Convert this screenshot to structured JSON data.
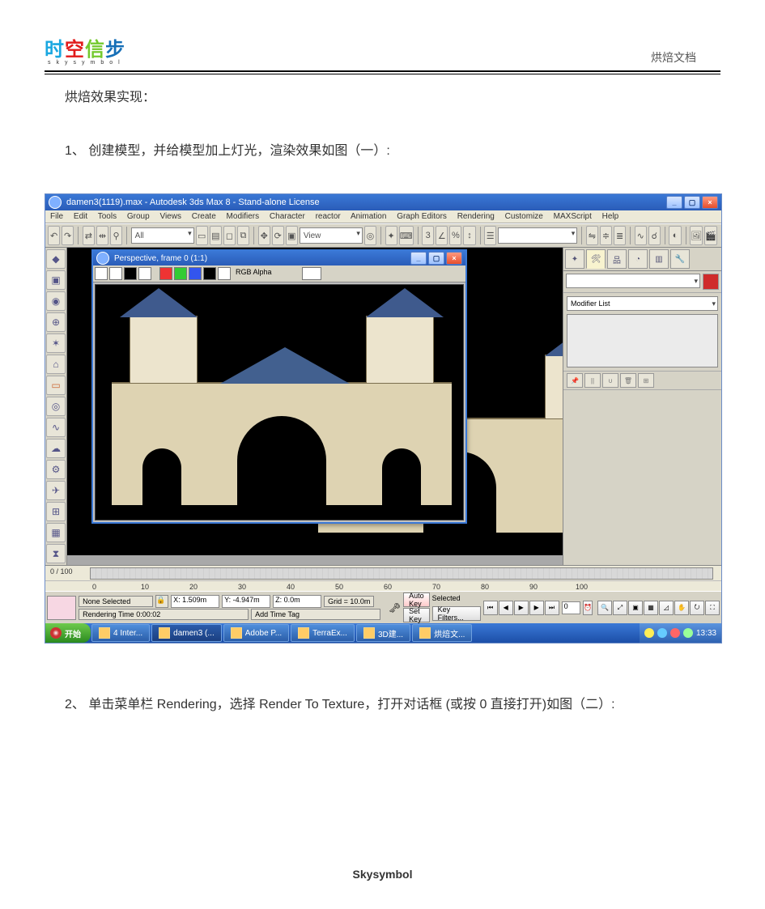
{
  "header": {
    "logo_chars": [
      "时",
      "空",
      "信",
      "步"
    ],
    "logo_sub": "skysymbol",
    "doc_label": "烘焙文档"
  },
  "body": {
    "headline": "烘焙效果实现：",
    "step1": "1、  创建模型，并给模型加上灯光，渲染效果如图（一）:",
    "step2": "2、  单击菜单栏 Rendering，选择 Render To Texture，打开对话框 (或按 0 直接打开)如图（二）:"
  },
  "app": {
    "title": "damen3(1119).max - Autodesk 3ds Max 8 - Stand-alone License",
    "menu": [
      "File",
      "Edit",
      "Tools",
      "Group",
      "Views",
      "Create",
      "Modifiers",
      "Character",
      "reactor",
      "Animation",
      "Graph Editors",
      "Rendering",
      "Customize",
      "MAXScript",
      "Help"
    ],
    "toolbar": {
      "ddl1": "All",
      "ddl2": "View"
    },
    "render_window": {
      "title": "Perspective, frame 0 (1:1)",
      "alpha_ddl": "RGB Alpha"
    },
    "cmdpanel": {
      "modifier_ddl": "Modifier List"
    },
    "timeline": {
      "pos": "0 / 100",
      "ticks": [
        "0",
        "10",
        "20",
        "30",
        "40",
        "50",
        "60",
        "70",
        "80",
        "90",
        "100"
      ]
    },
    "status": {
      "none_selected": "None Selected",
      "x": "X: 1.509m",
      "y": "Y: -4.947m",
      "z": "Z: 0.0m",
      "grid": "Grid = 10.0m",
      "autokey": "Auto Key",
      "setkey": "Set Key",
      "selected_ddl": "Selected",
      "keyfilter": "Key Filters...",
      "render_time": "Rendering Time 0:00:02",
      "add_time_tag": "Add Time Tag"
    },
    "taskbar": {
      "start": "开始",
      "items": [
        "4 Inter...",
        "damen3 (...",
        "Adobe P...",
        "TerraEx...",
        "3D建...",
        "烘焙文..."
      ],
      "clock": "13:33"
    }
  },
  "footer": {
    "brand": "Skysymbol"
  }
}
